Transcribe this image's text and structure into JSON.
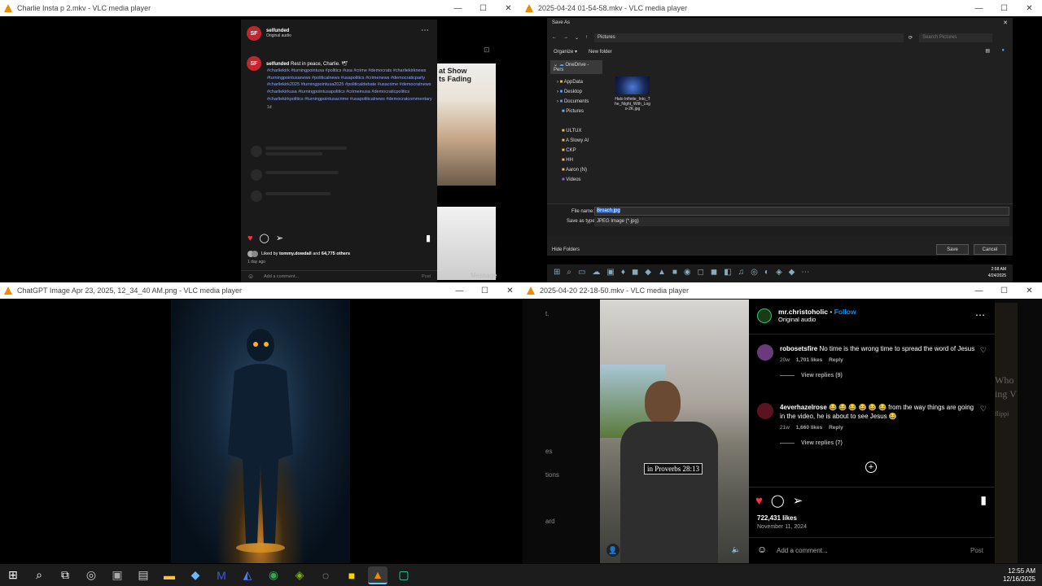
{
  "windows": {
    "tl": {
      "title": "Charlie Insta p 2.mkv - VLC media player",
      "post": {
        "account": "selfunded",
        "audio": "Original audio",
        "caption_user": "selfunded",
        "caption_text": "Rest in peace, Charlie. 🕊",
        "hashtags": "#charliekirk #turningpointusa #politics #usa #crime #democrats #charliekirknews #turningpointusanews #politicalnews #usapolitics #crimenews #democraticparty #charliekirk2025 #turningpointusa2025 #politicaldebate #usacrime #democratnews #charliekirkusa #turningpointusapolitics #crimeinusa #democraticpolitics #charliekirkpolitics #turningpointusacrime #usapoliticalnews #democratcommentary",
        "time_short": "1d",
        "liked_prefix": "Liked by",
        "liked_user": "tommy.dowdall",
        "liked_and": "and",
        "liked_others": "64,775 others",
        "time_ago": "1 day ago",
        "add_comment": "Add a comment...",
        "post_btn": "Post",
        "bg_text": "at Show\nts Fading",
        "message_label": "Message"
      }
    },
    "tr": {
      "title": "2025-04-24 01-54-58.mkv - VLC media player",
      "dialog": {
        "title": "Save As",
        "path_crumb": "Pictures",
        "refresh": "⟳",
        "search_placeholder": "Search Pictures",
        "organize": "Organize ▾",
        "new_folder": "New folder",
        "tree": [
          "OneDrive - Pers",
          "AppData",
          "Desktop",
          "Documents",
          "Pictures"
        ],
        "quick": [
          "ULTUX",
          "A Slowy Al",
          "CKP",
          "HH",
          "Aaron (N)",
          "Videos"
        ],
        "file_thumb_label": "Halo Infinite_Into_The_Night_With_Logo-2K.jpg",
        "file_name_label": "File name:",
        "file_name_value": "Broach.jpg",
        "save_type_label": "Save as type:",
        "save_type_value": "JPEG Image (*.jpg)",
        "hide_folders": "Hide Folders",
        "save_btn": "Save",
        "cancel_btn": "Cancel"
      },
      "mini_time": "2:58 AM",
      "mini_date": "4/24/2025"
    },
    "bl": {
      "title": "ChatGPT Image Apr 23, 2025, 12_34_40 AM.png - VLC media player"
    },
    "br": {
      "title": "2025-04-20 22-18-50.mkv - VLC media player",
      "left_fragments": [
        "t.",
        "es",
        "tions",
        "ard"
      ],
      "right_fragments": [
        "Who",
        "ing V",
        "flippi"
      ],
      "video_caption": "in Proverbs 28:13",
      "post": {
        "account": "mr.christoholic",
        "follow": "Follow",
        "audio": "Original audio",
        "comments": [
          {
            "user": "robosetsfire",
            "text": "No time is the wrong time to spread the word of Jesus",
            "age": "20w",
            "likes": "1,701 likes",
            "reply": "Reply",
            "view_replies": "View replies (9)"
          },
          {
            "user": "4everhazelrose",
            "text": "😂 😂 😂 😂 😂 😂 from the way things are going in the video, he is about to see Jesus 😂",
            "age": "21w",
            "likes": "1,660 likes",
            "reply": "Reply",
            "view_replies": "View replies (7)"
          }
        ],
        "likes": "722,431 likes",
        "date": "November 11, 2024",
        "add_comment": "Add a comment...",
        "post_btn": "Post"
      }
    }
  },
  "taskbar": {
    "time": "12:55 AM",
    "date": "12/16/2025"
  },
  "colors": {
    "ig_red": "#ff3040",
    "ig_blue": "#0095f6",
    "vlc_orange": "#f08a00",
    "taskbar": "#1c1c1c"
  }
}
